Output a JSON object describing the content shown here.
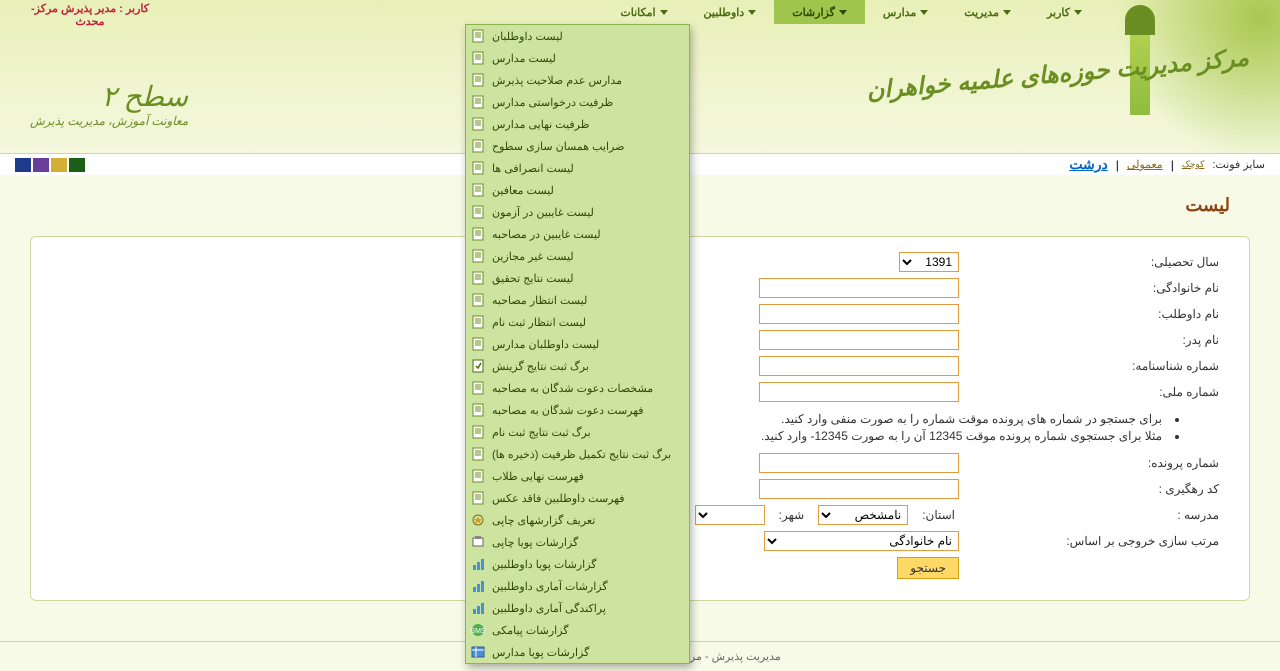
{
  "user_label": "کاربر : مدیر پذیرش مرکز- محدث",
  "nav": {
    "items": [
      {
        "label": "کاربر"
      },
      {
        "label": "مدیریت"
      },
      {
        "label": "مدارس"
      },
      {
        "label": "گزارشات"
      },
      {
        "label": "داوطلبین"
      },
      {
        "label": "امکانات"
      }
    ]
  },
  "calligraphy_text": "مرکز مدیریت حوزه‌های علمیه خواهران",
  "left_graphic_text": "سطح ۲",
  "left_graphic_sub": "معاونت آموزش، مدیریت پذیرش",
  "font_bar": {
    "label": "سایز فونت:",
    "small": "کوچک",
    "normal": "معمولی",
    "large": "درشت"
  },
  "colors": [
    "#1a5f1a",
    "#d4af37",
    "#6a3d9a",
    "#1e3a8a"
  ],
  "dropdown": {
    "items": [
      "لیست داوطلبان",
      "لیست مدارس",
      "مدارس عدم صلاحیت پذیرش",
      "ظرفیت درخواستی مدارس",
      "ظرفیت نهایی مدارس",
      "ضرایب همسان سازی سطوح",
      "لیست انصرافی ها",
      "لیست معافین",
      "لیست غایبین در آزمون",
      "لیست غایبین در مصاحبه",
      "لیست غیر مجازین",
      "لیست نتایج تحقیق",
      "لیست انتظار مصاحبه",
      "لیست انتظار ثبت نام",
      "لیست داوطلبان مدارس",
      "برگ ثبت نتایج گزینش",
      "مشخصات دعوت شدگان به مصاحبه",
      "فهرست دعوت شدگان به مصاحبه",
      "برگ ثبت نتایج ثبت نام",
      "برگ ثبت نتایج تکمیل ظرفیت (ذخیره ها)",
      "فهرست نهایی طلاب",
      "فهرست داوطلبین فاقد عکس",
      "تعریف گزارشهای چاپی",
      "گزارشات پویا چاپی",
      "گزارشات پویا داوطلبین",
      "گزارشات آماری داوطلبین",
      "پراکندگی آماری داوطلبین",
      "گزارشات پیامکی",
      "گزارشات پویا مدارس"
    ]
  },
  "page_title": "لیست",
  "form": {
    "year_label": "سال تحصیلی:",
    "year_value": "1391",
    "lastname_label": "نام خانوادگی:",
    "applicant_label": "نام داوطلب:",
    "father_label": "نام پدر:",
    "birth_cert_label": "شماره شناسنامه:",
    "national_id_label": "شماره ملی:",
    "file_no_label": "شماره پرونده:",
    "tracking_label": "کد رهگیری :",
    "school_label": "مدرسه :",
    "province_label": "استان:",
    "province_value": "نامشخص",
    "city_label": "شهر:",
    "sort_label": "مرتب سازی خروجی بر اساس:",
    "sort_value": "نام خانوادگی",
    "search_btn": "جستجو"
  },
  "notes": [
    "برای جستجو در شماره های پرونده موقت شماره را به صورت منفی وارد کنید.",
    "مثلا برای جستجوی شماره پرونده موقت 12345 آن را به صورت 12345- وارد کنید."
  ],
  "footer": "مدیریت پذیرش - مرکز مدیریت حوزه علمیه خواهران - ۲۰۱۰ ©"
}
